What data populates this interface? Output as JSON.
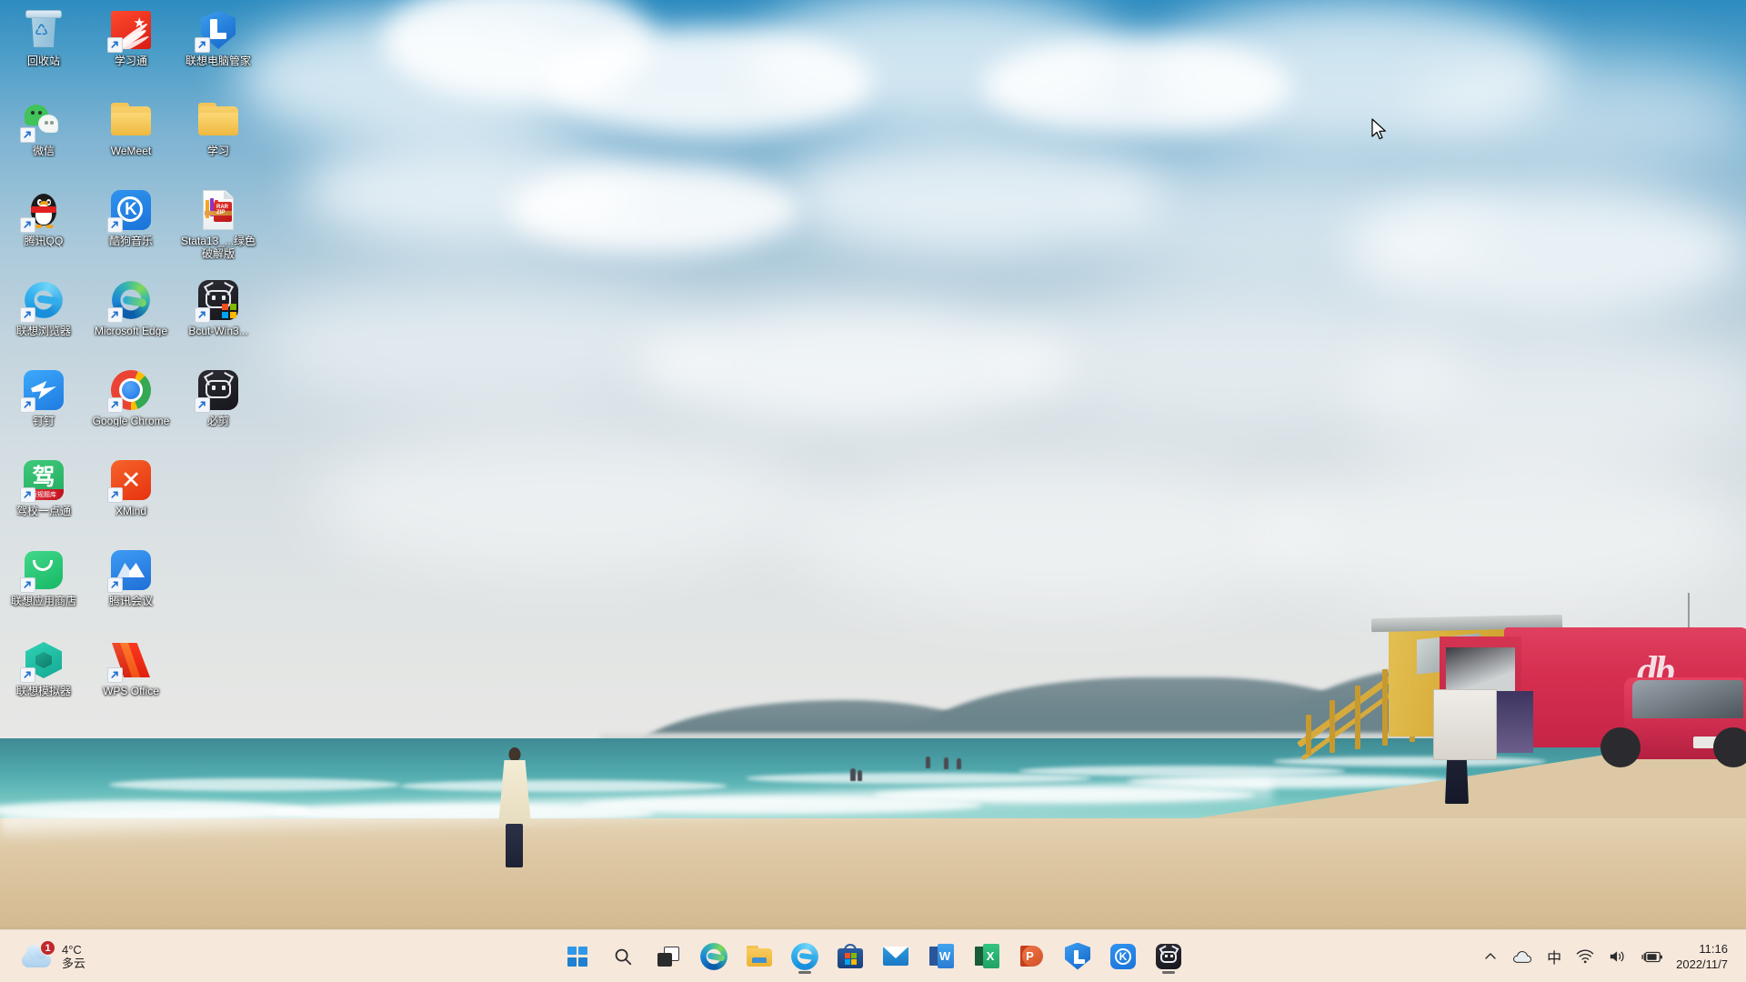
{
  "desktop": {
    "wallpaper_description": "Beach scene with turquoise sea, sand, lifeguard tower and red food truck",
    "icons": [
      {
        "label": "回收站",
        "icon": "recycle-bin-icon",
        "shortcut": false
      },
      {
        "label": "学习通",
        "icon": "chaoxing-icon",
        "shortcut": true
      },
      {
        "label": "联想电脑管家",
        "icon": "lenovo-pc-manager-icon",
        "shortcut": true
      },
      {
        "label": "微信",
        "icon": "wechat-icon",
        "shortcut": true
      },
      {
        "label": "WeMeet",
        "icon": "folder-icon",
        "shortcut": false
      },
      {
        "label": "学习",
        "icon": "folder-icon",
        "shortcut": false
      },
      {
        "label": "腾讯QQ",
        "icon": "qq-icon",
        "shortcut": true
      },
      {
        "label": "酷狗音乐",
        "icon": "kugou-music-icon",
        "shortcut": true
      },
      {
        "label": "Stata13_...绿色破解版",
        "icon": "rar-archive-icon",
        "shortcut": false
      },
      {
        "label": "联想浏览器",
        "icon": "lenovo-browser-icon",
        "shortcut": true
      },
      {
        "label": "Microsoft Edge",
        "icon": "edge-icon",
        "shortcut": true
      },
      {
        "label": "Bcut-Win3...",
        "icon": "bcut-installer-icon",
        "shortcut": true
      },
      {
        "label": "钉钉",
        "icon": "dingtalk-icon",
        "shortcut": true
      },
      {
        "label": "Google Chrome",
        "icon": "chrome-icon",
        "shortcut": true
      },
      {
        "label": "必剪",
        "icon": "bijian-icon",
        "shortcut": true
      },
      {
        "label": "驾校一点通",
        "icon": "driving-school-icon",
        "shortcut": true
      },
      {
        "label": "XMind",
        "icon": "xmind-icon",
        "shortcut": true
      },
      {
        "label": "",
        "icon": "empty",
        "shortcut": false
      },
      {
        "label": "联想应用商店",
        "icon": "lenovo-app-store-icon",
        "shortcut": true
      },
      {
        "label": "腾讯会议",
        "icon": "tencent-meeting-icon",
        "shortcut": true
      },
      {
        "label": "",
        "icon": "empty",
        "shortcut": false
      },
      {
        "label": "联想模拟器",
        "icon": "lenovo-emulator-icon",
        "shortcut": true
      },
      {
        "label": "WPS Office",
        "icon": "wps-office-icon",
        "shortcut": true
      },
      {
        "label": "",
        "icon": "empty",
        "shortcut": false
      }
    ]
  },
  "taskbar": {
    "weather": {
      "temperature": "4°C",
      "condition": "多云",
      "badge": "1",
      "icon": "cloud-icon"
    },
    "buttons": [
      {
        "name": "start-button",
        "icon": "windows-logo-icon",
        "running": false
      },
      {
        "name": "search-button",
        "icon": "search-icon",
        "running": false
      },
      {
        "name": "task-view-button",
        "icon": "task-view-icon",
        "running": false
      },
      {
        "name": "edge-button",
        "icon": "edge-icon",
        "running": false
      },
      {
        "name": "file-explorer-button",
        "icon": "folder-icon",
        "running": false
      },
      {
        "name": "lenovo-browser-button",
        "icon": "lenovo-browser-icon",
        "running": true
      },
      {
        "name": "microsoft-store-button",
        "icon": "microsoft-store-icon",
        "running": false
      },
      {
        "name": "mail-button",
        "icon": "mail-icon",
        "running": false
      },
      {
        "name": "word-button",
        "icon": "word-icon",
        "running": false
      },
      {
        "name": "excel-button",
        "icon": "excel-icon",
        "running": false
      },
      {
        "name": "powerpoint-button",
        "icon": "powerpoint-icon",
        "running": false
      },
      {
        "name": "lenovo-pc-manager-button",
        "icon": "lenovo-pc-manager-icon",
        "running": false
      },
      {
        "name": "kugou-music-button",
        "icon": "kugou-music-icon",
        "running": false
      },
      {
        "name": "bcut-button",
        "icon": "bcut-icon",
        "running": true
      }
    ],
    "tray": {
      "overflow_icon": "chevron-up-icon",
      "onedrive_icon": "cloud-icon",
      "ime_label": "中",
      "wifi_icon": "wifi-icon",
      "volume_icon": "speaker-icon",
      "battery_icon": "battery-charging-icon",
      "time": "11:16",
      "date": "2022/11/7"
    }
  },
  "colors": {
    "taskbar_bg": "#f7e8dc",
    "accent_blue": "#2b8fe0",
    "badge_red": "#c1272d",
    "sea_teal": "#4fa8ac",
    "sand": "#d8c099",
    "truck_red": "#d62f50",
    "tower_yellow": "#d8ad39"
  }
}
